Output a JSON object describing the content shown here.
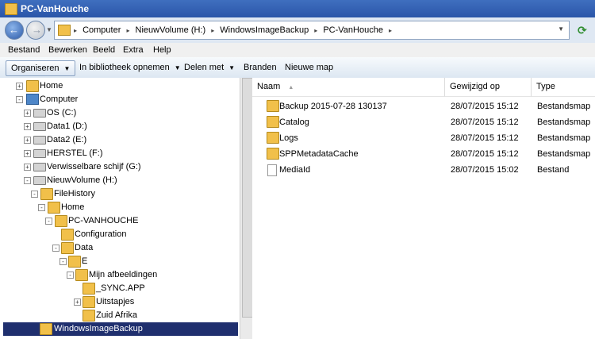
{
  "window": {
    "title": "PC-VanHouche"
  },
  "address": {
    "crumbs": [
      "Computer",
      "NieuwVolume (H:)",
      "WindowsImageBackup",
      "PC-VanHouche"
    ],
    "refresh_icon": "refresh-icon"
  },
  "menu": {
    "items": [
      "Bestand",
      "Bewerken",
      "Beeld",
      "Extra",
      "Help"
    ]
  },
  "commands": {
    "organize": "Organiseren",
    "library": "In bibliotheek opnemen",
    "share": "Delen met",
    "burn": "Branden",
    "new_folder": "Nieuwe map"
  },
  "columns": {
    "name": "Naam",
    "modified": "Gewijzigd op",
    "type": "Type"
  },
  "files": [
    {
      "name": "Backup 2015-07-28 130137",
      "modified": "28/07/2015 15:12",
      "type": "Bestandsmap",
      "icon": "folder-icon"
    },
    {
      "name": "Catalog",
      "modified": "28/07/2015 15:12",
      "type": "Bestandsmap",
      "icon": "folder-icon"
    },
    {
      "name": "Logs",
      "modified": "28/07/2015 15:12",
      "type": "Bestandsmap",
      "icon": "folder-icon"
    },
    {
      "name": "SPPMetadataCache",
      "modified": "28/07/2015 15:12",
      "type": "Bestandsmap",
      "icon": "folder-icon"
    },
    {
      "name": "MediaId",
      "modified": "28/07/2015 15:02",
      "type": "Bestand",
      "icon": "file-icon"
    }
  ],
  "tree": [
    {
      "label": "Home",
      "icon": "folder-icon",
      "expander": "+"
    },
    {
      "label": "Computer",
      "icon": "computer-icon",
      "expander": "-"
    },
    {
      "label": "OS (C:)",
      "icon": "drive-icon",
      "expander": "+"
    },
    {
      "label": "Data1 (D:)",
      "icon": "drive-icon",
      "expander": "+"
    },
    {
      "label": "Data2 (E:)",
      "icon": "drive-icon",
      "expander": "+"
    },
    {
      "label": "HERSTEL (F:)",
      "icon": "drive-icon",
      "expander": "+"
    },
    {
      "label": "Verwisselbare schijf (G:)",
      "icon": "drive-icon",
      "expander": "+"
    },
    {
      "label": "NieuwVolume (H:)",
      "icon": "drive-icon",
      "expander": "-"
    },
    {
      "label": "FileHistory",
      "icon": "folder-icon",
      "expander": "-"
    },
    {
      "label": "Home",
      "icon": "folder-icon",
      "expander": "-"
    },
    {
      "label": "PC-VANHOUCHE",
      "icon": "folder-icon",
      "expander": "-"
    },
    {
      "label": "Configuration",
      "icon": "folder-icon",
      "expander": ""
    },
    {
      "label": "Data",
      "icon": "folder-icon",
      "expander": "-"
    },
    {
      "label": "E",
      "icon": "folder-icon",
      "expander": "-"
    },
    {
      "label": "Mijn afbeeldingen",
      "icon": "folder-icon",
      "expander": "-"
    },
    {
      "label": "_SYNC.APP",
      "icon": "folder-icon",
      "expander": ""
    },
    {
      "label": "Uitstapjes",
      "icon": "folder-icon",
      "expander": "+"
    },
    {
      "label": "Zuid Afrika",
      "icon": "folder-icon",
      "expander": ""
    },
    {
      "label": "WindowsImageBackup",
      "icon": "folder-icon",
      "expander": "",
      "selected": true
    }
  ]
}
